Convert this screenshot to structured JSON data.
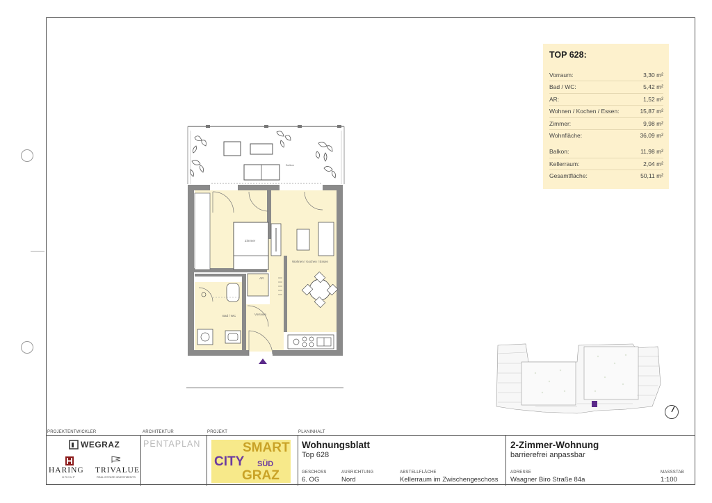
{
  "area_table": {
    "title": "TOP 628:",
    "rows": [
      {
        "label": "Vorraum:",
        "value": "3,30 m²"
      },
      {
        "label": "Bad / WC:",
        "value": "5,42 m²"
      },
      {
        "label": "AR:",
        "value": "1,52 m²"
      },
      {
        "label": "Wohnen / Kochen / Essen:",
        "value": "15,87 m²"
      },
      {
        "label": "Zimmer:",
        "value": "9,98 m²"
      },
      {
        "label": "Wohnfläche:",
        "value": "36,09 m²"
      }
    ],
    "rows2": [
      {
        "label": "Balkon:",
        "value": "11,98 m²"
      },
      {
        "label": "Kellerraum:",
        "value": "2,04 m²"
      },
      {
        "label": "Gesamtfläche:",
        "value": "50,11 m²"
      }
    ]
  },
  "plan_labels": {
    "balkon": "Balkon",
    "zimmer": "Zimmer",
    "wohnen": "Wohnen / Kochen / Essen",
    "ar": "AR",
    "bad": "Bad / WC",
    "vorraum": "Vorraum"
  },
  "colors": {
    "room_fill": "#fbf3d0",
    "wall": "#8a8a8a",
    "area_box": "#fdf1cd",
    "highlight_unit": "#5b2a8a",
    "smartcity_purple": "#6b3aa0",
    "smartcity_gold": "#c9a227"
  },
  "titleblock": {
    "developer_label": "PROJEKTENTWICKLER",
    "architect_label": "ARCHITEKTUR",
    "project_label": "PROJEKT",
    "plan_label": "PLANINHALT",
    "developer_logo": "WEGRAZ",
    "haring_logo": "HARING",
    "haring_sub": "GROUP",
    "trivalue_logo": "TRIVALUE",
    "trivalue_sub": "REAL ESTATE INVESTMENTS",
    "architect_logo": "PENTAPLAN",
    "project_logo": {
      "smart": "SMART",
      "city": "CITY",
      "sud": "SÜD",
      "graz": "GRAZ"
    },
    "doc_title": "Wohnungsblatt",
    "doc_sub": "Top 628",
    "fields": [
      {
        "label": "GESCHOSS",
        "value": "6. OG"
      },
      {
        "label": "AUSRICHTUNG",
        "value": "Nord"
      },
      {
        "label": "ABSTELLFLÄCHE",
        "value": "Kellerraum im Zwischengeschoss"
      }
    ],
    "apt_title": "2-Zimmer-Wohnung",
    "apt_sub": "barrierefrei anpassbar",
    "address_label": "ADRESSE",
    "address": "Waagner Biro Straße 84a",
    "scale_label": "MASSSTAB",
    "scale": "1:100"
  }
}
